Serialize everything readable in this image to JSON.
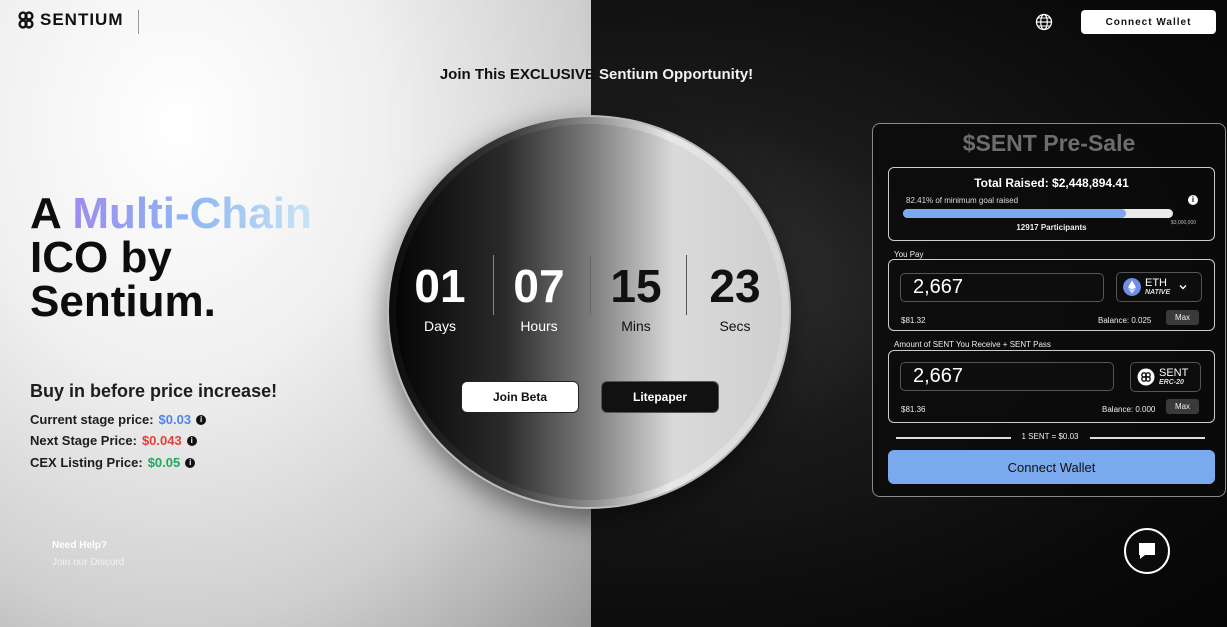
{
  "header": {
    "logo_text": "SENTIUM",
    "connect_wallet": "Connect Wallet",
    "headline_left": "Join This EXCLUSIVE",
    "headline_right": " Sentium Opportunity!"
  },
  "hero": {
    "line1_a": "A ",
    "line1_b": "Multi-Chain",
    "line2": "ICO by",
    "line3": "Sentium."
  },
  "pricing": {
    "heading": "Buy in before price increase!",
    "rows": [
      {
        "label": "Current stage price:",
        "value": "$0.03",
        "color": "#4f86ee"
      },
      {
        "label": "Next Stage Price:",
        "value": "$0.043",
        "color": "#e2413b"
      },
      {
        "label": "CEX Listing Price:",
        "value": "$0.05",
        "color": "#1ea85b"
      }
    ]
  },
  "help": {
    "title": "Need Help?",
    "discord": "Join our Discord"
  },
  "countdown": {
    "days": {
      "value": "01",
      "label": "Days"
    },
    "hours": {
      "value": "07",
      "label": "Hours"
    },
    "mins": {
      "value": "15",
      "label": "Mins"
    },
    "secs": {
      "value": "23",
      "label": "Secs"
    },
    "join_beta": "Join Beta",
    "litepaper": "Litepaper"
  },
  "presale": {
    "title": "$SENT Pre-Sale",
    "total_raised": "Total Raised: $2,448,894.41",
    "min_goal_text": "82.41% of minimum goal raised",
    "progress_percent": 82.41,
    "goal_amount": "$3,000,000",
    "participants": "12917 Participants",
    "you_pay_label": "You Pay",
    "pay_amount": "2,667",
    "pay_token": "ETH",
    "pay_token_sub": "NATIVE",
    "pay_usd": "$81.32",
    "pay_balance": "Balance: 0.025",
    "max_label": "Max",
    "receive_label": "Amount of SENT You Receive + SENT Pass",
    "receive_amount": "2,667",
    "receive_token": "SENT",
    "receive_token_sub": "ERC-20",
    "receive_usd": "$81.36",
    "receive_balance": "Balance: 0.000",
    "rate": "1 SENT = $0.03",
    "connect_wallet": "Connect Wallet"
  },
  "icons": {
    "logo": "sentium-logo-icon",
    "globe": "globe-icon",
    "info": "info-icon",
    "eth": "eth-token-icon",
    "sent": "sent-token-icon",
    "chevron": "chevron-down-icon",
    "chat": "chat-icon"
  }
}
